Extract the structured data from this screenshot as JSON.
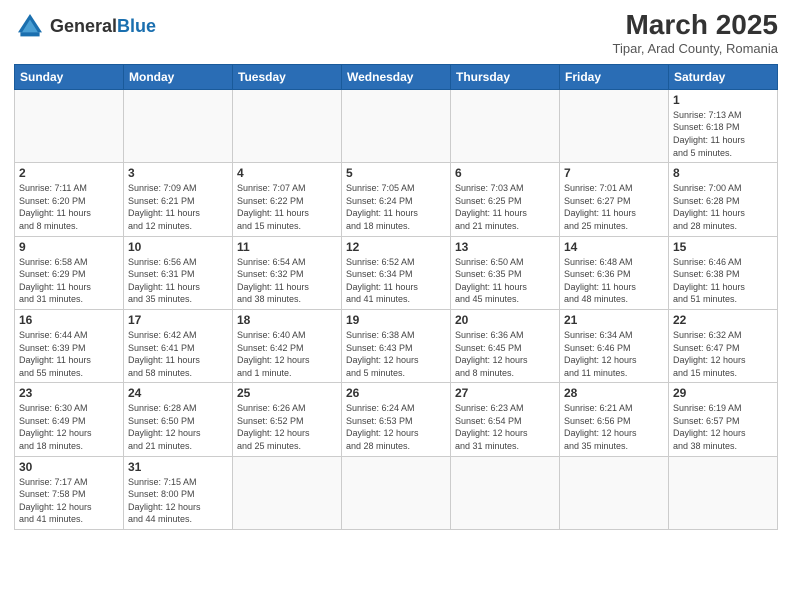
{
  "header": {
    "logo_general": "General",
    "logo_blue": "Blue",
    "title": "March 2025",
    "subtitle": "Tipar, Arad County, Romania"
  },
  "weekdays": [
    "Sunday",
    "Monday",
    "Tuesday",
    "Wednesday",
    "Thursday",
    "Friday",
    "Saturday"
  ],
  "days": [
    {
      "date": "",
      "info": ""
    },
    {
      "date": "",
      "info": ""
    },
    {
      "date": "",
      "info": ""
    },
    {
      "date": "",
      "info": ""
    },
    {
      "date": "",
      "info": ""
    },
    {
      "date": "",
      "info": ""
    },
    {
      "date": "1",
      "info": "Sunrise: 7:13 AM\nSunset: 6:18 PM\nDaylight: 11 hours\nand 5 minutes."
    },
    {
      "date": "2",
      "info": "Sunrise: 7:11 AM\nSunset: 6:20 PM\nDaylight: 11 hours\nand 8 minutes."
    },
    {
      "date": "3",
      "info": "Sunrise: 7:09 AM\nSunset: 6:21 PM\nDaylight: 11 hours\nand 12 minutes."
    },
    {
      "date": "4",
      "info": "Sunrise: 7:07 AM\nSunset: 6:22 PM\nDaylight: 11 hours\nand 15 minutes."
    },
    {
      "date": "5",
      "info": "Sunrise: 7:05 AM\nSunset: 6:24 PM\nDaylight: 11 hours\nand 18 minutes."
    },
    {
      "date": "6",
      "info": "Sunrise: 7:03 AM\nSunset: 6:25 PM\nDaylight: 11 hours\nand 21 minutes."
    },
    {
      "date": "7",
      "info": "Sunrise: 7:01 AM\nSunset: 6:27 PM\nDaylight: 11 hours\nand 25 minutes."
    },
    {
      "date": "8",
      "info": "Sunrise: 7:00 AM\nSunset: 6:28 PM\nDaylight: 11 hours\nand 28 minutes."
    },
    {
      "date": "9",
      "info": "Sunrise: 6:58 AM\nSunset: 6:29 PM\nDaylight: 11 hours\nand 31 minutes."
    },
    {
      "date": "10",
      "info": "Sunrise: 6:56 AM\nSunset: 6:31 PM\nDaylight: 11 hours\nand 35 minutes."
    },
    {
      "date": "11",
      "info": "Sunrise: 6:54 AM\nSunset: 6:32 PM\nDaylight: 11 hours\nand 38 minutes."
    },
    {
      "date": "12",
      "info": "Sunrise: 6:52 AM\nSunset: 6:34 PM\nDaylight: 11 hours\nand 41 minutes."
    },
    {
      "date": "13",
      "info": "Sunrise: 6:50 AM\nSunset: 6:35 PM\nDaylight: 11 hours\nand 45 minutes."
    },
    {
      "date": "14",
      "info": "Sunrise: 6:48 AM\nSunset: 6:36 PM\nDaylight: 11 hours\nand 48 minutes."
    },
    {
      "date": "15",
      "info": "Sunrise: 6:46 AM\nSunset: 6:38 PM\nDaylight: 11 hours\nand 51 minutes."
    },
    {
      "date": "16",
      "info": "Sunrise: 6:44 AM\nSunset: 6:39 PM\nDaylight: 11 hours\nand 55 minutes."
    },
    {
      "date": "17",
      "info": "Sunrise: 6:42 AM\nSunset: 6:41 PM\nDaylight: 11 hours\nand 58 minutes."
    },
    {
      "date": "18",
      "info": "Sunrise: 6:40 AM\nSunset: 6:42 PM\nDaylight: 12 hours\nand 1 minute."
    },
    {
      "date": "19",
      "info": "Sunrise: 6:38 AM\nSunset: 6:43 PM\nDaylight: 12 hours\nand 5 minutes."
    },
    {
      "date": "20",
      "info": "Sunrise: 6:36 AM\nSunset: 6:45 PM\nDaylight: 12 hours\nand 8 minutes."
    },
    {
      "date": "21",
      "info": "Sunrise: 6:34 AM\nSunset: 6:46 PM\nDaylight: 12 hours\nand 11 minutes."
    },
    {
      "date": "22",
      "info": "Sunrise: 6:32 AM\nSunset: 6:47 PM\nDaylight: 12 hours\nand 15 minutes."
    },
    {
      "date": "23",
      "info": "Sunrise: 6:30 AM\nSunset: 6:49 PM\nDaylight: 12 hours\nand 18 minutes."
    },
    {
      "date": "24",
      "info": "Sunrise: 6:28 AM\nSunset: 6:50 PM\nDaylight: 12 hours\nand 21 minutes."
    },
    {
      "date": "25",
      "info": "Sunrise: 6:26 AM\nSunset: 6:52 PM\nDaylight: 12 hours\nand 25 minutes."
    },
    {
      "date": "26",
      "info": "Sunrise: 6:24 AM\nSunset: 6:53 PM\nDaylight: 12 hours\nand 28 minutes."
    },
    {
      "date": "27",
      "info": "Sunrise: 6:23 AM\nSunset: 6:54 PM\nDaylight: 12 hours\nand 31 minutes."
    },
    {
      "date": "28",
      "info": "Sunrise: 6:21 AM\nSunset: 6:56 PM\nDaylight: 12 hours\nand 35 minutes."
    },
    {
      "date": "29",
      "info": "Sunrise: 6:19 AM\nSunset: 6:57 PM\nDaylight: 12 hours\nand 38 minutes."
    },
    {
      "date": "30",
      "info": "Sunrise: 7:17 AM\nSunset: 7:58 PM\nDaylight: 12 hours\nand 41 minutes."
    },
    {
      "date": "31",
      "info": "Sunrise: 7:15 AM\nSunset: 8:00 PM\nDaylight: 12 hours\nand 44 minutes."
    },
    {
      "date": "",
      "info": ""
    },
    {
      "date": "",
      "info": ""
    },
    {
      "date": "",
      "info": ""
    },
    {
      "date": "",
      "info": ""
    },
    {
      "date": "",
      "info": ""
    }
  ]
}
